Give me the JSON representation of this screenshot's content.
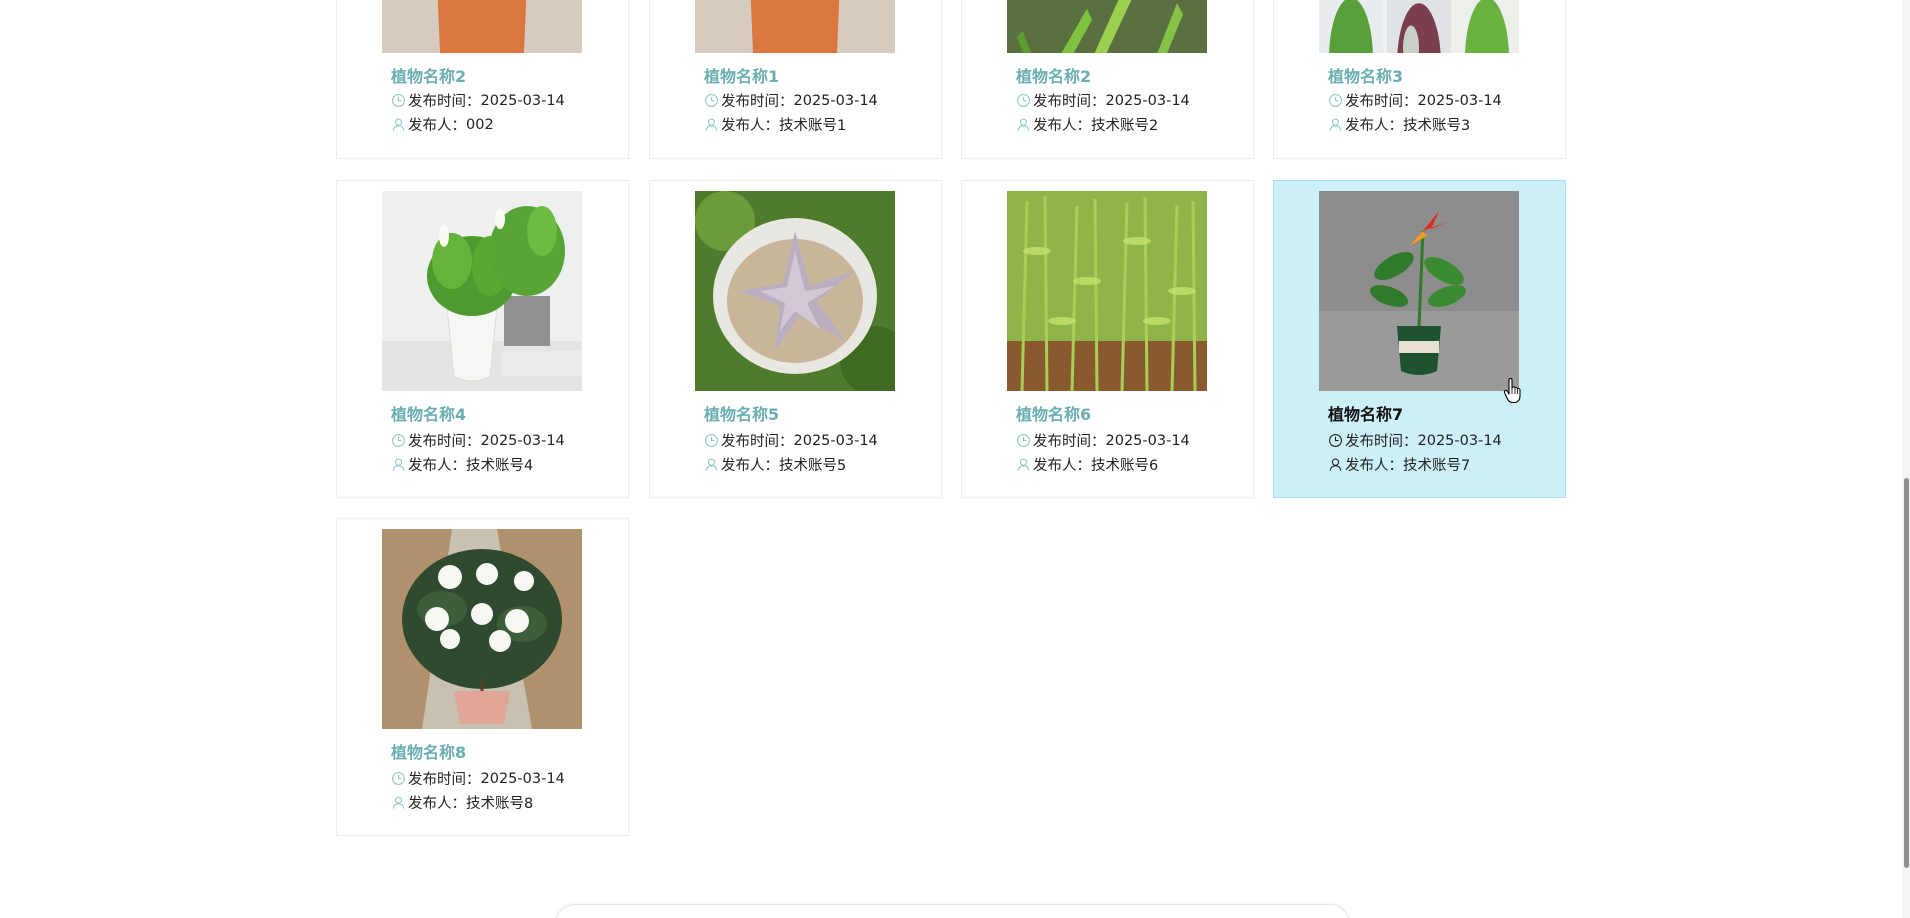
{
  "labels": {
    "time_prefix": "发布时间：",
    "publisher_prefix": "发布人："
  },
  "colors": {
    "accent": "#6bafb3",
    "highlight_bg": "#cdf0f8"
  },
  "icons": {
    "time": "clock-icon",
    "publisher": "user-icon"
  },
  "cards": [
    {
      "name": "植物名称2",
      "time": "2025-03-14",
      "publisher": "002",
      "image": "potted-plant-photo"
    },
    {
      "name": "植物名称1",
      "time": "2025-03-14",
      "publisher": "技术账号1",
      "image": "potted-plant-photo"
    },
    {
      "name": "植物名称2",
      "time": "2025-03-14",
      "publisher": "技术账号2",
      "image": "grass-leaves-photo"
    },
    {
      "name": "植物名称3",
      "time": "2025-03-14",
      "publisher": "技术账号3",
      "image": "three-potted-plants-photo"
    },
    {
      "name": "植物名称4",
      "time": "2025-03-14",
      "publisher": "技术账号4",
      "image": "peace-lily-photo"
    },
    {
      "name": "植物名称5",
      "time": "2025-03-14",
      "publisher": "技术账号5",
      "image": "succulent-photo"
    },
    {
      "name": "植物名称6",
      "time": "2025-03-14",
      "publisher": "技术账号6",
      "image": "bamboo-seedlings-photo"
    },
    {
      "name": "植物名称7",
      "time": "2025-03-14",
      "publisher": "技术账号7",
      "image": "bird-of-paradise-photo",
      "highlighted": true
    },
    {
      "name": "植物名称8",
      "time": "2025-03-14",
      "publisher": "技术账号8",
      "image": "gardenia-photo"
    }
  ]
}
